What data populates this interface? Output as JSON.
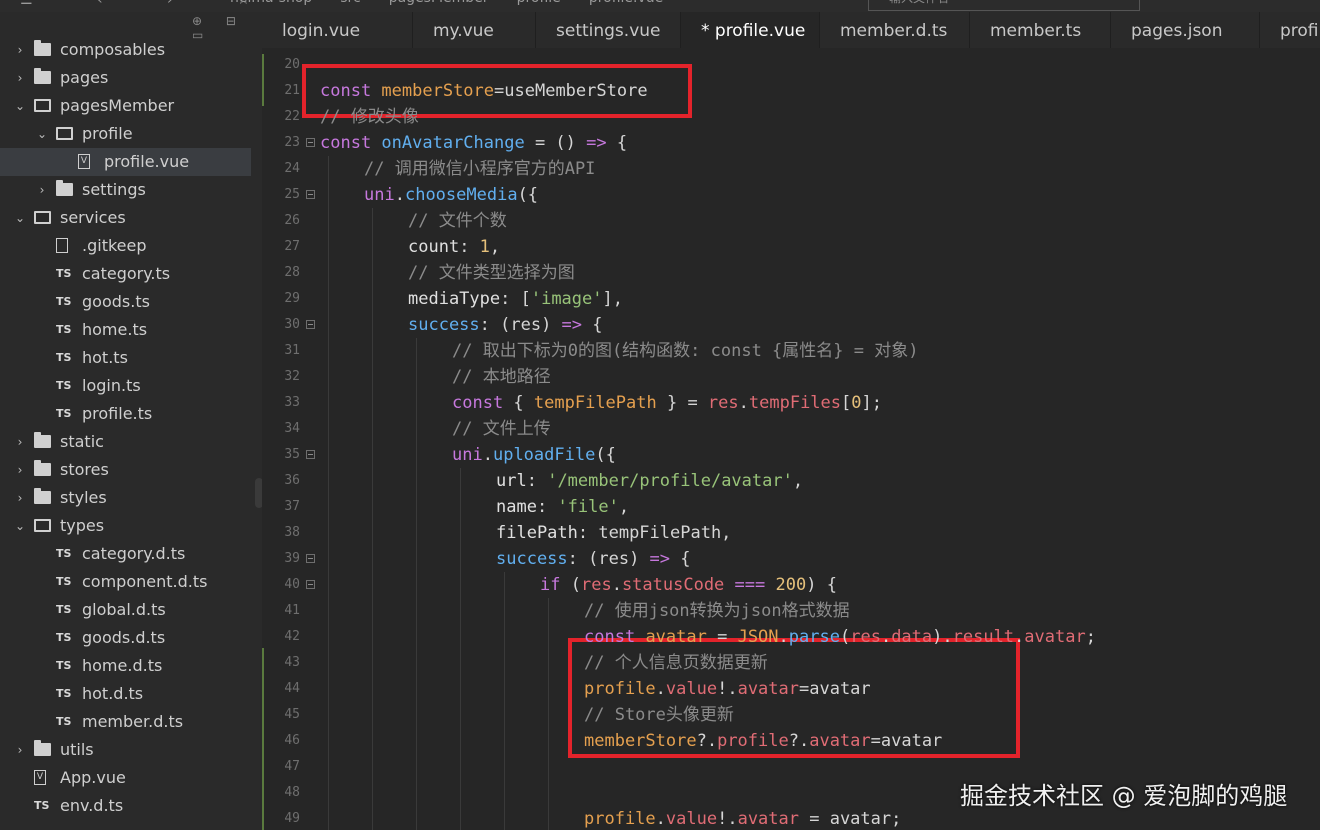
{
  "topbar": {
    "breadcrumbs": [
      "heima-shop",
      "src",
      "pagesMember",
      "profile",
      "profile.vue"
    ],
    "search_placeholder": "输入文件名"
  },
  "sidebar": {
    "items": [
      {
        "label": "composables",
        "type": "folder",
        "depth": 0,
        "expanded": false
      },
      {
        "label": "pages",
        "type": "folder",
        "depth": 0,
        "expanded": false
      },
      {
        "label": "pagesMember",
        "type": "folder",
        "depth": 0,
        "expanded": true
      },
      {
        "label": "profile",
        "type": "folder",
        "depth": 1,
        "expanded": true
      },
      {
        "label": "profile.vue",
        "type": "vue",
        "depth": 2,
        "selected": true
      },
      {
        "label": "settings",
        "type": "folder",
        "depth": 1,
        "expanded": false
      },
      {
        "label": "services",
        "type": "folder",
        "depth": 0,
        "expanded": true
      },
      {
        "label": ".gitkeep",
        "type": "file",
        "depth": 1
      },
      {
        "label": "category.ts",
        "type": "ts",
        "depth": 1
      },
      {
        "label": "goods.ts",
        "type": "ts",
        "depth": 1
      },
      {
        "label": "home.ts",
        "type": "ts",
        "depth": 1
      },
      {
        "label": "hot.ts",
        "type": "ts",
        "depth": 1
      },
      {
        "label": "login.ts",
        "type": "ts",
        "depth": 1
      },
      {
        "label": "profile.ts",
        "type": "ts",
        "depth": 1
      },
      {
        "label": "static",
        "type": "folder",
        "depth": 0,
        "expanded": false
      },
      {
        "label": "stores",
        "type": "folder",
        "depth": 0,
        "expanded": false
      },
      {
        "label": "styles",
        "type": "folder",
        "depth": 0,
        "expanded": false
      },
      {
        "label": "types",
        "type": "folder",
        "depth": 0,
        "expanded": true
      },
      {
        "label": "category.d.ts",
        "type": "ts",
        "depth": 1
      },
      {
        "label": "component.d.ts",
        "type": "ts",
        "depth": 1
      },
      {
        "label": "global.d.ts",
        "type": "ts",
        "depth": 1
      },
      {
        "label": "goods.d.ts",
        "type": "ts",
        "depth": 1
      },
      {
        "label": "home.d.ts",
        "type": "ts",
        "depth": 1
      },
      {
        "label": "hot.d.ts",
        "type": "ts",
        "depth": 1
      },
      {
        "label": "member.d.ts",
        "type": "ts",
        "depth": 1
      },
      {
        "label": "utils",
        "type": "folder",
        "depth": 0,
        "expanded": false
      },
      {
        "label": "App.vue",
        "type": "vue",
        "depth": 0
      },
      {
        "label": "env.d.ts",
        "type": "ts",
        "depth": 0
      }
    ]
  },
  "tabs": [
    {
      "label": "login.vue",
      "active": false
    },
    {
      "label": "my.vue",
      "active": false
    },
    {
      "label": "settings.vue",
      "active": false
    },
    {
      "label": "* profile.vue",
      "active": true
    },
    {
      "label": "member.d.ts",
      "active": false
    },
    {
      "label": "member.ts",
      "active": false
    },
    {
      "label": "pages.json",
      "active": false
    },
    {
      "label": "profil",
      "active": false
    }
  ],
  "editor": {
    "lines": [
      {
        "n": "20",
        "indent": 0,
        "fold": false,
        "tokens": []
      },
      {
        "n": "21",
        "indent": 0,
        "fold": false,
        "tokens": [
          [
            "kw",
            "const "
          ],
          [
            "var",
            "memberStore"
          ],
          [
            "pl",
            "="
          ],
          [
            "pl",
            "useMemberStore"
          ]
        ]
      },
      {
        "n": "22",
        "indent": 0,
        "fold": false,
        "tokens": [
          [
            "cm",
            "// 修改头像"
          ]
        ]
      },
      {
        "n": "23",
        "indent": 0,
        "fold": true,
        "tokens": [
          [
            "kw",
            "const "
          ],
          [
            "fn",
            "onAvatarChange"
          ],
          [
            "pl",
            " = () "
          ],
          [
            "kw",
            "=>"
          ],
          [
            "pl",
            " {"
          ]
        ]
      },
      {
        "n": "24",
        "indent": 1,
        "fold": false,
        "tokens": [
          [
            "cm",
            "// 调用微信小程序官方的API"
          ]
        ]
      },
      {
        "n": "25",
        "indent": 1,
        "fold": true,
        "tokens": [
          [
            "kw",
            "uni"
          ],
          [
            "pl",
            "."
          ],
          [
            "fn",
            "chooseMedia"
          ],
          [
            "pl",
            "({"
          ]
        ]
      },
      {
        "n": "26",
        "indent": 2,
        "fold": false,
        "tokens": [
          [
            "cm",
            "// 文件个数"
          ]
        ]
      },
      {
        "n": "27",
        "indent": 2,
        "fold": false,
        "tokens": [
          [
            "prop",
            "count"
          ],
          [
            "pl",
            ": "
          ],
          [
            "num",
            "1"
          ],
          [
            "pl",
            ","
          ]
        ]
      },
      {
        "n": "28",
        "indent": 2,
        "fold": false,
        "tokens": [
          [
            "cm",
            "// 文件类型选择为图"
          ]
        ]
      },
      {
        "n": "29",
        "indent": 2,
        "fold": false,
        "tokens": [
          [
            "prop",
            "mediaType"
          ],
          [
            "pl",
            ": ["
          ],
          [
            "str",
            "'image'"
          ],
          [
            "pl",
            "],"
          ]
        ]
      },
      {
        "n": "30",
        "indent": 2,
        "fold": true,
        "tokens": [
          [
            "fn",
            "success"
          ],
          [
            "pl",
            ": (res) "
          ],
          [
            "kw",
            "=>"
          ],
          [
            "pl",
            " {"
          ]
        ]
      },
      {
        "n": "31",
        "indent": 3,
        "fold": false,
        "tokens": [
          [
            "cm",
            "// 取出下标为0的图(结构函数: const {属性名} = 对象)"
          ]
        ]
      },
      {
        "n": "32",
        "indent": 3,
        "fold": false,
        "tokens": [
          [
            "cm",
            "// 本地路径"
          ]
        ]
      },
      {
        "n": "33",
        "indent": 3,
        "fold": false,
        "tokens": [
          [
            "kw",
            "const"
          ],
          [
            "pl",
            " { "
          ],
          [
            "var",
            "tempFilePath"
          ],
          [
            "pl",
            " } = "
          ],
          [
            "red",
            "res"
          ],
          [
            "pl",
            "."
          ],
          [
            "red",
            "tempFiles"
          ],
          [
            "pl",
            "["
          ],
          [
            "num",
            "0"
          ],
          [
            "pl",
            "];"
          ]
        ]
      },
      {
        "n": "34",
        "indent": 3,
        "fold": false,
        "tokens": [
          [
            "cm",
            "// 文件上传"
          ]
        ]
      },
      {
        "n": "35",
        "indent": 3,
        "fold": true,
        "tokens": [
          [
            "kw",
            "uni"
          ],
          [
            "pl",
            "."
          ],
          [
            "fn",
            "uploadFile"
          ],
          [
            "pl",
            "({"
          ]
        ]
      },
      {
        "n": "36",
        "indent": 4,
        "fold": false,
        "tokens": [
          [
            "prop",
            "url"
          ],
          [
            "pl",
            ": "
          ],
          [
            "str",
            "'/member/profile/avatar'"
          ],
          [
            "pl",
            ","
          ]
        ]
      },
      {
        "n": "37",
        "indent": 4,
        "fold": false,
        "tokens": [
          [
            "prop",
            "name"
          ],
          [
            "pl",
            ": "
          ],
          [
            "str",
            "'file'"
          ],
          [
            "pl",
            ","
          ]
        ]
      },
      {
        "n": "38",
        "indent": 4,
        "fold": false,
        "tokens": [
          [
            "prop",
            "filePath"
          ],
          [
            "pl",
            ": tempFilePath,"
          ]
        ]
      },
      {
        "n": "39",
        "indent": 4,
        "fold": true,
        "tokens": [
          [
            "fn",
            "success"
          ],
          [
            "pl",
            ": (res) "
          ],
          [
            "kw",
            "=>"
          ],
          [
            "pl",
            " {"
          ]
        ]
      },
      {
        "n": "40",
        "indent": 5,
        "fold": true,
        "tokens": [
          [
            "kw",
            "if"
          ],
          [
            "pl",
            " ("
          ],
          [
            "red",
            "res"
          ],
          [
            "pl",
            "."
          ],
          [
            "red",
            "statusCode"
          ],
          [
            "pl",
            " "
          ],
          [
            "kw",
            "==="
          ],
          [
            "pl",
            " "
          ],
          [
            "num",
            "200"
          ],
          [
            "pl",
            ") {"
          ]
        ]
      },
      {
        "n": "41",
        "indent": 6,
        "fold": false,
        "tokens": [
          [
            "cm",
            "// 使用json转换为json格式数据"
          ]
        ]
      },
      {
        "n": "42",
        "indent": 6,
        "fold": false,
        "tokens": [
          [
            "kw",
            "const"
          ],
          [
            "pl",
            " "
          ],
          [
            "var",
            "avatar"
          ],
          [
            "pl",
            " = "
          ],
          [
            "var",
            "JSON"
          ],
          [
            "pl",
            "."
          ],
          [
            "fn",
            "parse"
          ],
          [
            "pl",
            "("
          ],
          [
            "red",
            "res"
          ],
          [
            "pl",
            "."
          ],
          [
            "red",
            "data"
          ],
          [
            "pl",
            ")."
          ],
          [
            "red",
            "result"
          ],
          [
            "pl",
            "."
          ],
          [
            "red",
            "avatar"
          ],
          [
            "pl",
            ";"
          ]
        ]
      },
      {
        "n": "43",
        "indent": 6,
        "fold": false,
        "tokens": [
          [
            "cm",
            "// 个人信息页数据更新"
          ]
        ]
      },
      {
        "n": "44",
        "indent": 6,
        "fold": false,
        "tokens": [
          [
            "var",
            "profile"
          ],
          [
            "pl",
            "."
          ],
          [
            "red",
            "value"
          ],
          [
            "pl",
            "!."
          ],
          [
            "red",
            "avatar"
          ],
          [
            "pl",
            "=avatar"
          ]
        ]
      },
      {
        "n": "45",
        "indent": 6,
        "fold": false,
        "tokens": [
          [
            "cm",
            "// Store头像更新"
          ]
        ]
      },
      {
        "n": "46",
        "indent": 6,
        "fold": false,
        "tokens": [
          [
            "var",
            "memberStore"
          ],
          [
            "pl",
            "?."
          ],
          [
            "red",
            "profile"
          ],
          [
            "pl",
            "?."
          ],
          [
            "red",
            "avatar"
          ],
          [
            "pl",
            "=avatar"
          ]
        ]
      },
      {
        "n": "47",
        "indent": 6,
        "fold": false,
        "tokens": []
      },
      {
        "n": "48",
        "indent": 6,
        "fold": false,
        "tokens": []
      },
      {
        "n": "49",
        "indent": 6,
        "fold": false,
        "tokens": [
          [
            "var",
            "profile"
          ],
          [
            "pl",
            "."
          ],
          [
            "red",
            "value"
          ],
          [
            "pl",
            "!."
          ],
          [
            "red",
            "avatar"
          ],
          [
            "pl",
            " = avatar;"
          ]
        ]
      }
    ]
  },
  "watermark": "掘金技术社区 @ 爱泡脚的鸡腿",
  "colors": {
    "highlight": "#e3232b",
    "keyword": "#c678dd",
    "variable": "#e5a04f",
    "function": "#61afef",
    "string": "#98c379",
    "comment": "#8b8b8b"
  }
}
